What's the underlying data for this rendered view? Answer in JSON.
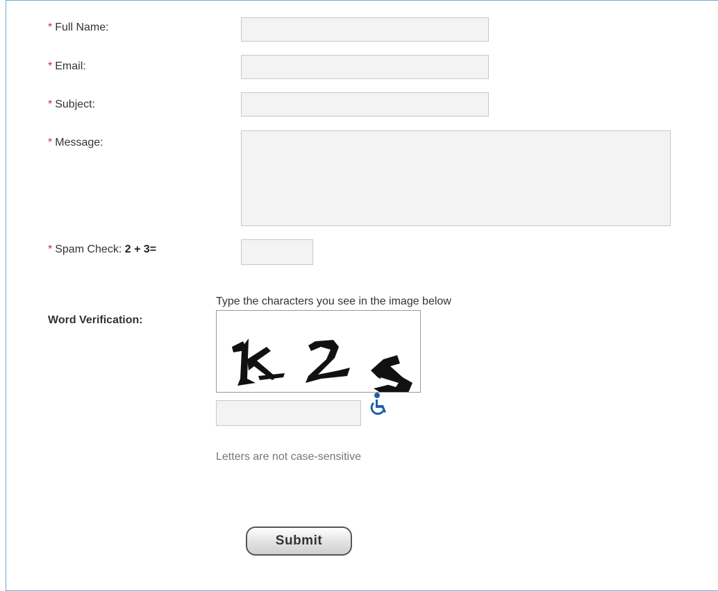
{
  "form": {
    "required_mark": "*",
    "full_name": {
      "label": "Full Name:",
      "value": ""
    },
    "email": {
      "label": "Email:",
      "value": ""
    },
    "subject": {
      "label": "Subject:",
      "value": ""
    },
    "message": {
      "label": "Message:",
      "value": ""
    },
    "spam_check": {
      "label": "Spam Check:",
      "question": "2 + 3=",
      "value": ""
    },
    "word_verification": {
      "label": "Word Verification:",
      "hint": "Type the characters you see in the image below",
      "captcha_text": "k2a",
      "value": "",
      "case_note": "Letters are not case-sensitive",
      "accessibility_icon": "wheelchair-icon"
    },
    "submit_label": "Submit"
  },
  "colors": {
    "required": "#d42c2c",
    "frame_border": "#6aaed6",
    "field_bg": "#f3f3f3",
    "access_icon": "#1f5fa8"
  }
}
